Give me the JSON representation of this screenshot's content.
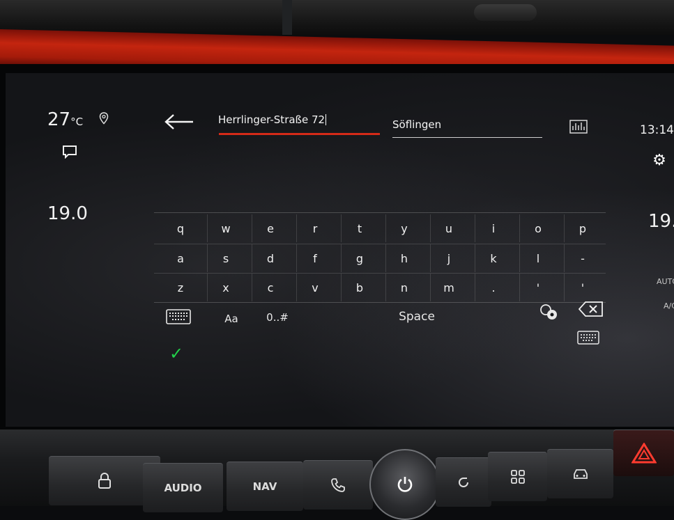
{
  "climate": {
    "outside_temp": "27",
    "outside_temp_unit": "°C",
    "left_setpoint": "19.0",
    "right_setpoint": "19.",
    "auto_label": "AUTO",
    "ac_label": "A/C"
  },
  "time": "13:14",
  "search": {
    "address_value": "Herrlinger-Straße 72",
    "district_value": "Söflingen"
  },
  "keyboard": {
    "row1": [
      "q",
      "w",
      "e",
      "r",
      "t",
      "y",
      "u",
      "i",
      "o",
      "p"
    ],
    "row2": [
      "a",
      "s",
      "d",
      "f",
      "g",
      "h",
      "j",
      "k",
      "l",
      "-"
    ],
    "row3": [
      "z",
      "x",
      "c",
      "v",
      "b",
      "n",
      "m",
      ".",
      "'",
      "'"
    ],
    "case_label": "Aa",
    "symbols_label": "0..#",
    "space_label": "Space"
  },
  "hardware_buttons": {
    "audio_label": "AUDIO",
    "nav_label": "NAV"
  },
  "colors": {
    "accent_underline": "#d42a18",
    "confirm_green": "#22d04a"
  },
  "icons": {
    "location": "pin-icon",
    "message": "chat-icon",
    "settings": "gear-icon",
    "back": "back-arrow-icon",
    "map": "map-icon",
    "keyboard": "keyboard-icon",
    "language": "language-icon",
    "backspace": "backspace-icon",
    "confirm": "checkmark-icon"
  }
}
